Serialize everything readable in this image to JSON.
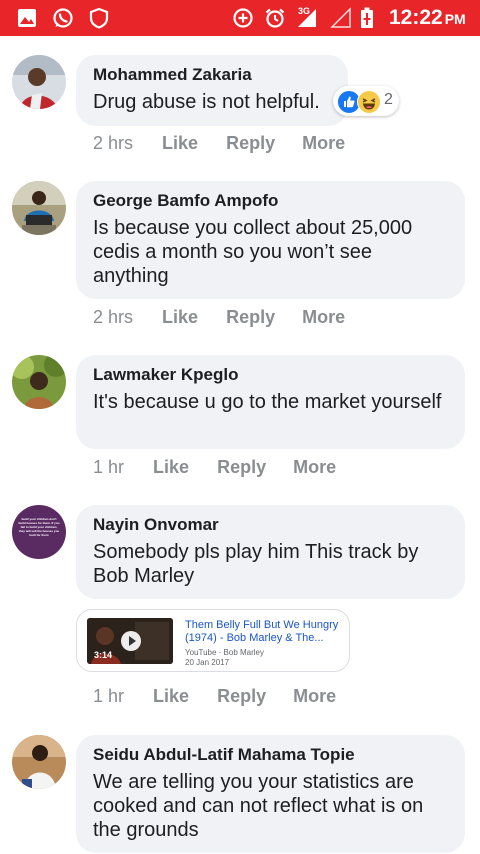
{
  "status_bar": {
    "time": "12:22",
    "ampm": "PM",
    "network": "3G",
    "left_icons": [
      "gallery-icon",
      "whatsapp-icon",
      "shield-icon"
    ],
    "right_icons": [
      "data-saver-icon",
      "alarm-icon",
      "signal-icon",
      "signal-empty-icon",
      "battery-charging-icon"
    ],
    "bar_color": "#e8262a"
  },
  "comments": [
    {
      "author": "Mohammed Zakaria",
      "text": "Drug abuse is not helpful.",
      "time": "2 hrs",
      "reactions": {
        "types": [
          "like-icon",
          "haha-icon"
        ],
        "count": "2"
      },
      "actions": {
        "like": "Like",
        "reply": "Reply",
        "more": "More"
      }
    },
    {
      "author": "George Bamfo Ampofo",
      "text": "Is because you collect about 25,000 cedis a month so you won’t see anything",
      "time": "2 hrs",
      "actions": {
        "like": "Like",
        "reply": "Reply",
        "more": "More"
      }
    },
    {
      "author": "Lawmaker Kpeglo",
      "text": "It's because u go to the market yourself",
      "time": "1 hr",
      "actions": {
        "like": "Like",
        "reply": "Reply",
        "more": "More"
      }
    },
    {
      "author": "Nayin Onvomar",
      "text": "Somebody pls play him This track by Bob Marley",
      "time": "1 hr",
      "avatar_text": "build your children don't build houses for them. If you fail to build your children, they will sell the houses you built for them",
      "link": {
        "title": "Them Belly Full But We Hungry (1974) - Bob Marley & The...",
        "source": "YouTube · Bob Marley",
        "date": "20 Jan 2017",
        "duration": "3:14"
      },
      "actions": {
        "like": "Like",
        "reply": "Reply",
        "more": "More"
      }
    },
    {
      "author": "Seidu Abdul-Latif Mahama Topie",
      "text": "We are telling you your statistics are cooked and can not reflect what is on the grounds"
    }
  ],
  "colors": {
    "bubble": "#f0f2f5",
    "meta_text": "#8a8d91",
    "link_title": "#1a55c9",
    "like_blue": "#1877f2"
  }
}
